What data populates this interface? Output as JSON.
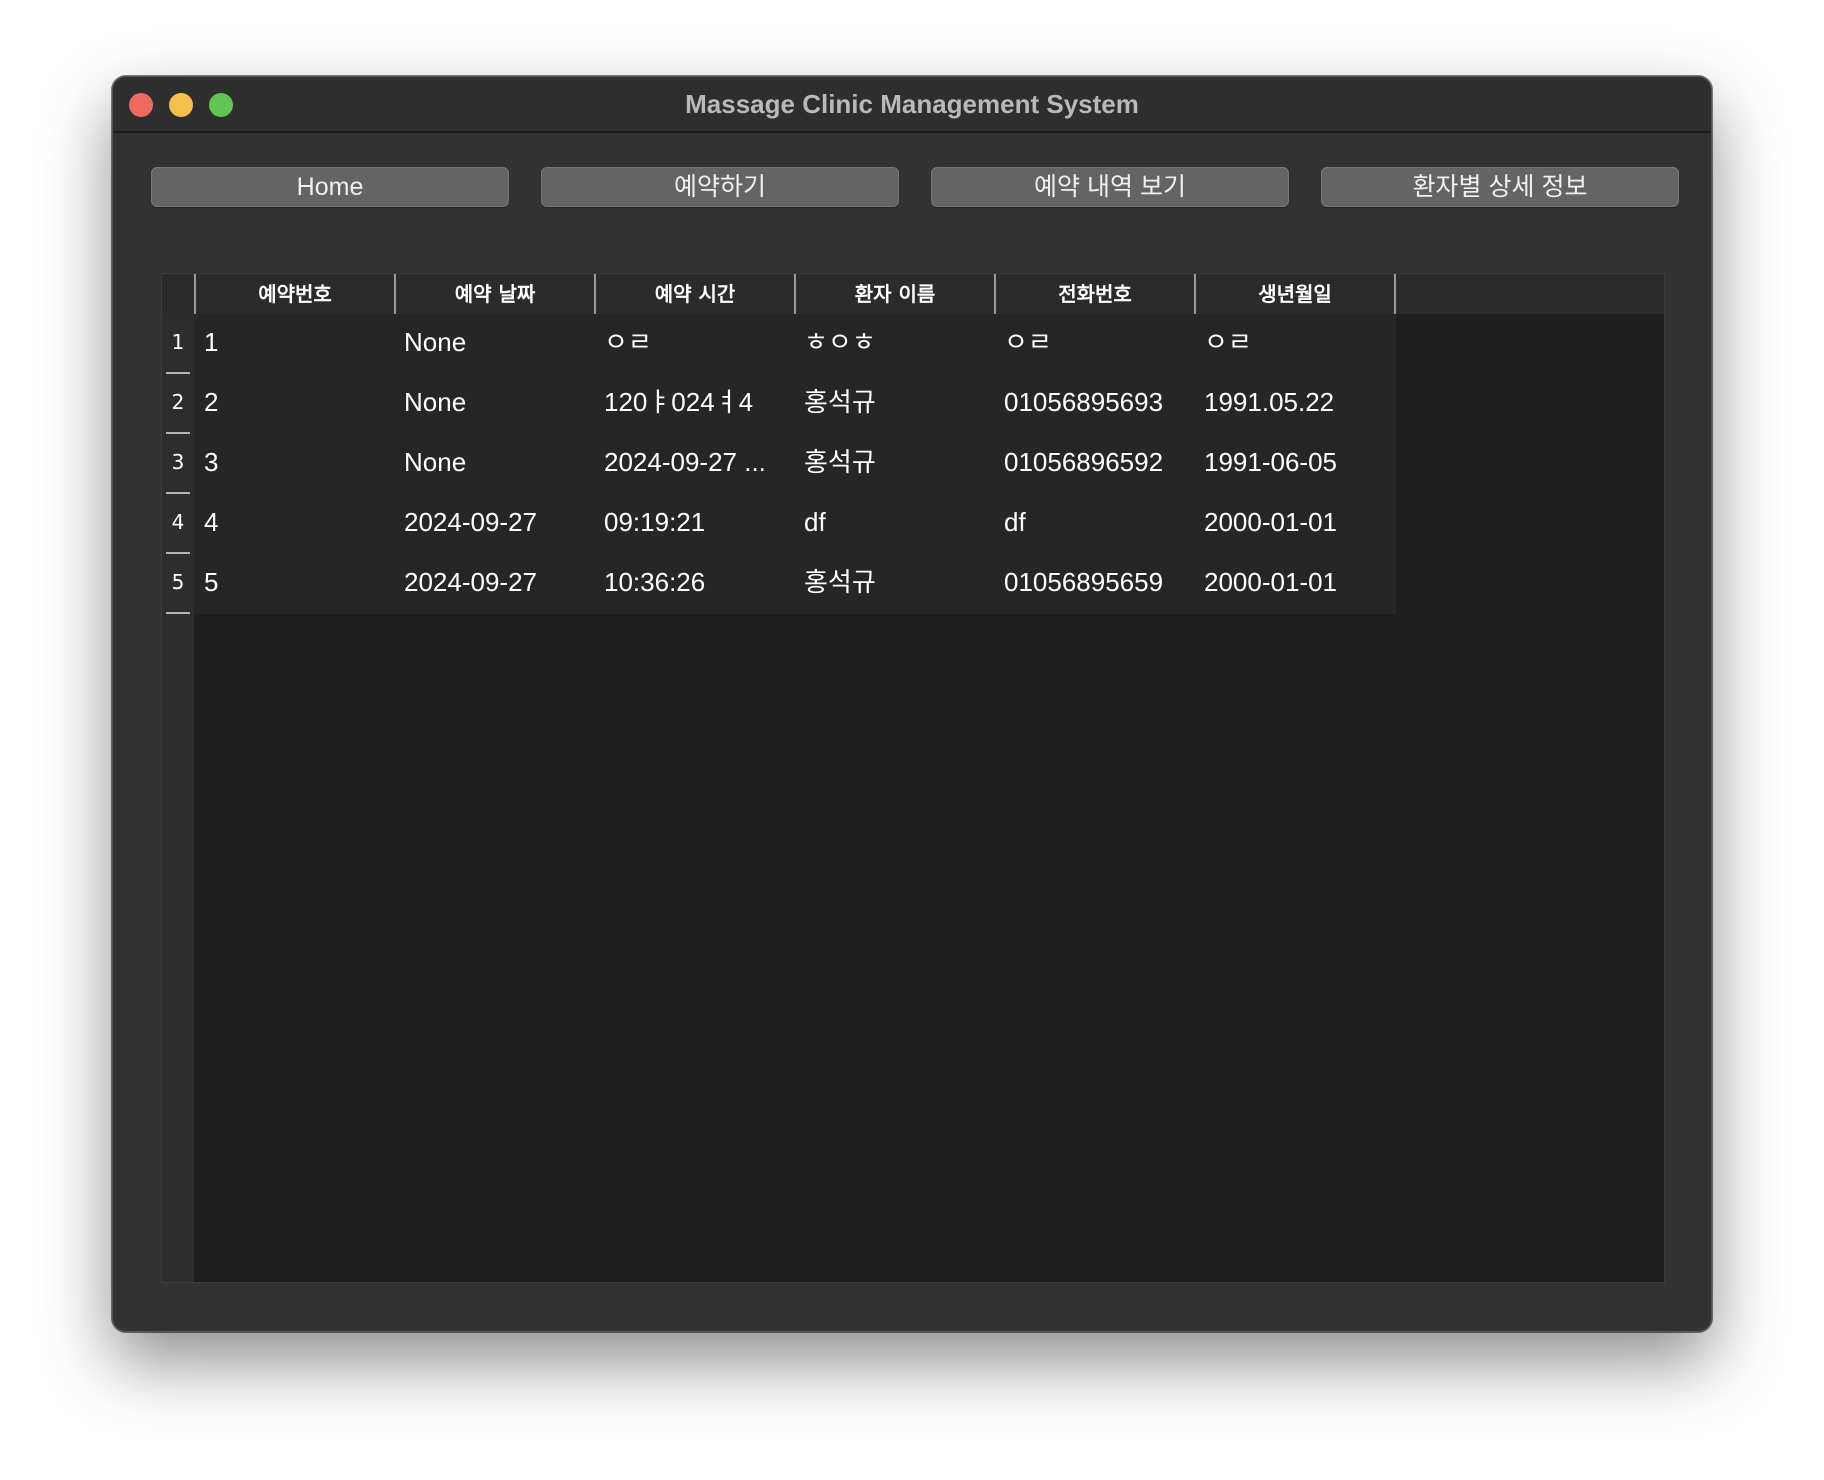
{
  "window": {
    "title": "Massage Clinic Management System"
  },
  "nav": {
    "home": "Home",
    "reserve": "예약하기",
    "history": "예약 내역 보기",
    "patient_detail": "환자별 상세 정보"
  },
  "table": {
    "columns": [
      "예약번호",
      "예약 날짜",
      "예약 시간",
      "환자 이름",
      "전화번호",
      "생년월일"
    ],
    "row_numbers": [
      "1",
      "2",
      "3",
      "4",
      "5"
    ],
    "rows": [
      [
        "1",
        "None",
        "ㅇㄹ",
        "ㅎㅇㅎ",
        "ㅇㄹ",
        "ㅇㄹ"
      ],
      [
        "2",
        "None",
        "120ㅑ024ㅕ4",
        "홍석규",
        "01056895693",
        "1991.05.22"
      ],
      [
        "3",
        "None",
        "2024-09-27 ...",
        "홍석규",
        "01056896592",
        "1991-06-05"
      ],
      [
        "4",
        "2024-09-27",
        "09:19:21",
        "df",
        "df",
        "2000-01-01"
      ],
      [
        "5",
        "2024-09-27",
        "10:36:26",
        "홍석규",
        "01056895659",
        "2000-01-01"
      ]
    ]
  },
  "colors": {
    "window_bg": "#323232",
    "table_bg": "#1e1e1e",
    "button_bg": "#646464",
    "close": "#ed6a5e",
    "minimize": "#f5bf4f",
    "maximize": "#61c554"
  }
}
